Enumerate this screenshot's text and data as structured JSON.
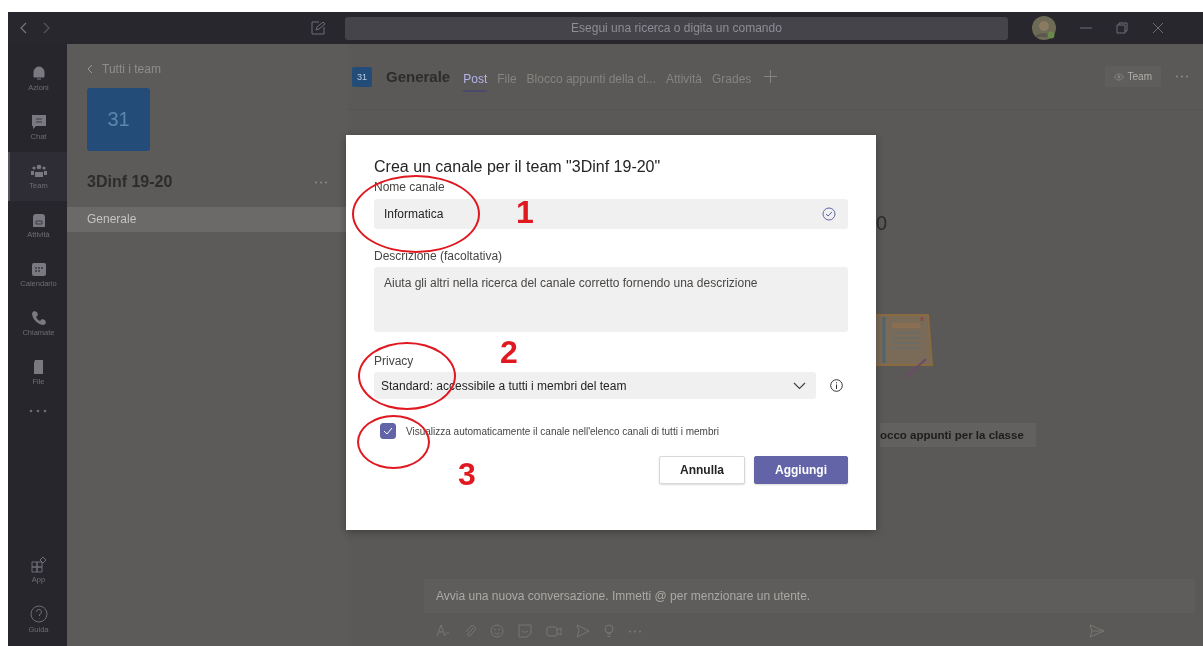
{
  "search": {
    "placeholder": "Esegui una ricerca o digita un comando"
  },
  "rail": [
    {
      "kind": "bell",
      "label": "Azioni",
      "selected": false
    },
    {
      "kind": "chat",
      "label": "Chat",
      "selected": false
    },
    {
      "kind": "team",
      "label": "Team",
      "selected": true
    },
    {
      "kind": "bag",
      "label": "Attività",
      "selected": false
    },
    {
      "kind": "calendar",
      "label": "Calendario",
      "selected": false
    },
    {
      "kind": "phone",
      "label": "Chiamate",
      "selected": false
    },
    {
      "kind": "file",
      "label": "File",
      "selected": false
    }
  ],
  "rail_bottom": [
    {
      "kind": "apps",
      "label": "App"
    },
    {
      "kind": "help",
      "label": "Guida"
    }
  ],
  "team_panel": {
    "back_link": "Tutti i team",
    "avatar": "31",
    "name": "3Dinf 19-20",
    "channels": [
      {
        "name": "Generale",
        "selected": true
      }
    ]
  },
  "channel_header": {
    "avatar": "31",
    "title": "Generale",
    "tabs": [
      {
        "label": "Post",
        "selected": true
      },
      {
        "label": "File",
        "selected": false
      },
      {
        "label": "Blocco appunti della cl...",
        "selected": false
      },
      {
        "label": "Attività",
        "selected": false
      },
      {
        "label": "Grades",
        "selected": false
      }
    ],
    "team_button": "Team"
  },
  "background": {
    "heading_fragment": "0",
    "button_fragment": "occo appunti per la classe"
  },
  "compose": {
    "placeholder": "Avvia una nuova conversazione. Immetti @ per menzionare un utente."
  },
  "dialog": {
    "title": "Crea un canale per il team \"3Dinf 19-20\"",
    "name_label": "Nome canale",
    "name_value": "Informatica",
    "name_valid": true,
    "description_label": "Descrizione (facoltativa)",
    "description_placeholder": "Aiuta gli altri nella ricerca del canale corretto fornendo una descrizione",
    "privacy_label": "Privacy",
    "privacy_value": "Standard: accessibile a tutti i membri del team",
    "auto_show": {
      "label": "Visualizza automaticamente il canale nell'elenco canali di tutti i membri",
      "checked": true
    },
    "buttons": [
      {
        "label": "Annulla",
        "kind": "secondary"
      },
      {
        "label": "Aggiungi",
        "kind": "primary"
      }
    ]
  },
  "annotations": [
    {
      "label": "1"
    },
    {
      "label": "2"
    },
    {
      "label": "3"
    }
  ]
}
